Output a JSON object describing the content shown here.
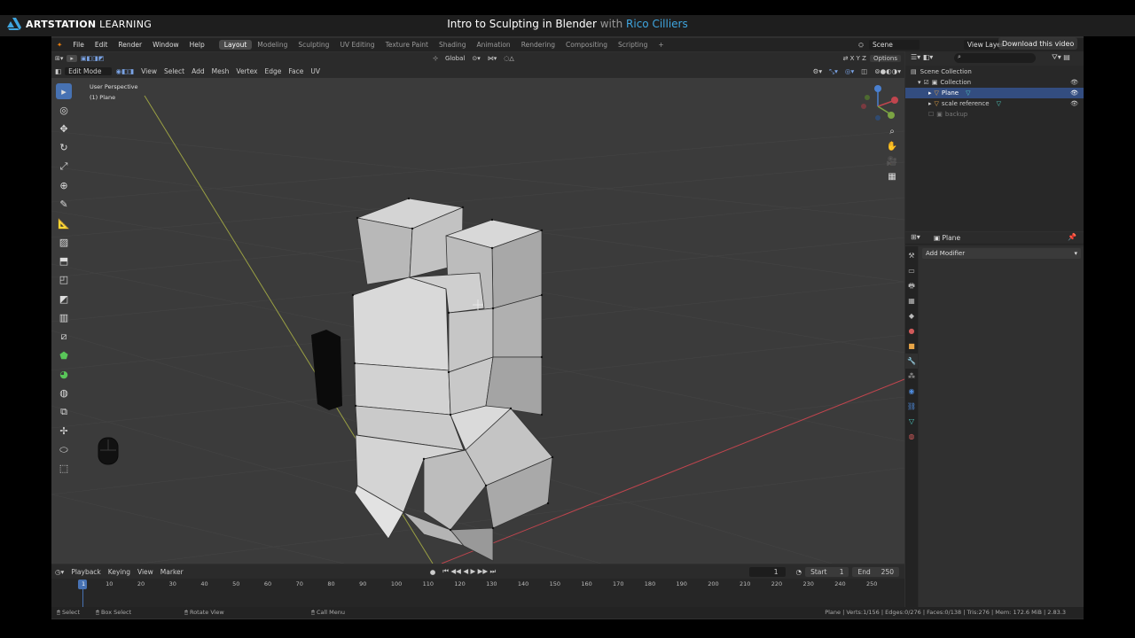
{
  "overlay": {
    "logo_strong": "ARTSTATION",
    "logo_rest": " LEARNING",
    "title_main": "Intro to Sculpting in Blender",
    "title_with": "with",
    "title_author": "Rico Cilliers",
    "download_label": "Download this video"
  },
  "menu": {
    "items": [
      "File",
      "Edit",
      "Render",
      "Window",
      "Help"
    ],
    "workspaces": [
      "Layout",
      "Modeling",
      "Sculpting",
      "UV Editing",
      "Texture Paint",
      "Shading",
      "Animation",
      "Rendering",
      "Compositing",
      "Scripting",
      "+"
    ],
    "scene_label": "Scene",
    "view_layer_label": "View Layer"
  },
  "viewport_header": {
    "transform_space": "Global",
    "options_label": "Options",
    "mode": "Edit Mode",
    "menus": [
      "View",
      "Select",
      "Add",
      "Mesh",
      "Vertex",
      "Edge",
      "Face",
      "UV"
    ]
  },
  "viewport": {
    "perspective_label": "User Perspective",
    "object_label": "(1) Plane"
  },
  "outliner": {
    "root": "Scene Collection",
    "collection": "Collection",
    "items": [
      "Plane",
      "scale reference",
      "backup"
    ]
  },
  "properties": {
    "object_name": "Plane",
    "add_modifier": "Add Modifier"
  },
  "timeline": {
    "menus": [
      "Playback",
      "Keying",
      "View",
      "Marker"
    ],
    "current_frame": "1",
    "start_label": "Start",
    "start_value": "1",
    "end_label": "End",
    "end_value": "250",
    "frame_ticks": [
      "1",
      "10",
      "20",
      "30",
      "40",
      "50",
      "60",
      "70",
      "80",
      "90",
      "100",
      "110",
      "120",
      "130",
      "140",
      "150",
      "160",
      "170",
      "180",
      "190",
      "200",
      "210",
      "220",
      "230",
      "240",
      "250"
    ]
  },
  "statusbar": {
    "select": "Select",
    "box_select": "Box Select",
    "rotate_view": "Rotate View",
    "call_menu": "Call Menu",
    "stats": "Plane | Verts:1/156 | Edges:0/276 | Faces:0/138 | Tris:276 | Mem: 172.6 MiB | 2.83.3"
  },
  "colors": {
    "accent": "#4772b3",
    "artstation_blue": "#3fa6e0",
    "x_axis": "#c0454e",
    "y_axis": "#9aa043"
  }
}
